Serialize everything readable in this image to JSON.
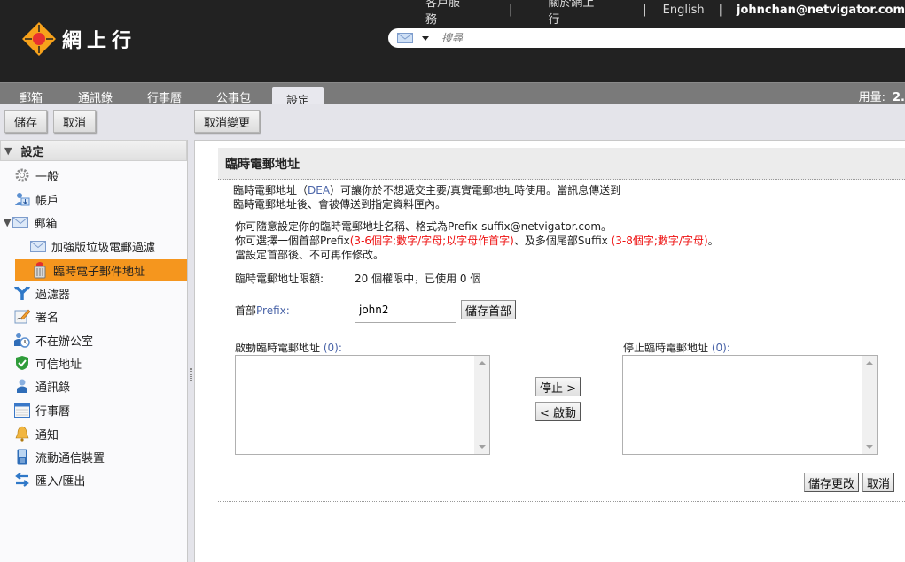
{
  "brand": {
    "name": "網上行"
  },
  "top_links": {
    "customer_service": "客戶服務",
    "about": "關於網上行",
    "language": "English",
    "separator": "|",
    "user_email": "johnchan@netvigator.com"
  },
  "search": {
    "placeholder": "搜尋",
    "mode_icon": "mail-icon"
  },
  "tabs": [
    {
      "label": "郵箱",
      "active": false
    },
    {
      "label": "通訊錄",
      "active": false
    },
    {
      "label": "行事曆",
      "active": false
    },
    {
      "label": "公事包",
      "active": false
    },
    {
      "label": "設定",
      "active": true
    }
  ],
  "usage": {
    "label": "用量:",
    "value": "2."
  },
  "toolbar": {
    "save": "儲存",
    "cancel": "取消",
    "undo_changes": "取消變更"
  },
  "sidebar": {
    "header": "設定",
    "items": [
      {
        "label": "一般",
        "icon": "gear-icon"
      },
      {
        "label": "帳戶",
        "icon": "account-icon"
      },
      {
        "label": "郵箱",
        "icon": "envelope-icon",
        "expanded": true
      },
      {
        "label": "加強版垃圾電郵過濾",
        "icon": "envelope-icon",
        "child": true
      },
      {
        "label": "臨時電子郵件地址",
        "icon": "trash-bin-icon",
        "child": true,
        "selected": true
      },
      {
        "label": "過濾器",
        "icon": "filter-fork-icon"
      },
      {
        "label": "署名",
        "icon": "signature-icon"
      },
      {
        "label": "不在辦公室",
        "icon": "out-of-office-icon"
      },
      {
        "label": "可信地址",
        "icon": "shield-check-icon"
      },
      {
        "label": "通訊錄",
        "icon": "contact-person-icon"
      },
      {
        "label": "行事曆",
        "icon": "calendar-icon"
      },
      {
        "label": "通知",
        "icon": "bell-icon"
      },
      {
        "label": "流動通信裝置",
        "icon": "mobile-device-icon"
      },
      {
        "label": "匯入/匯出",
        "icon": "import-export-icon"
      }
    ]
  },
  "main": {
    "title": "臨時電郵地址",
    "intro_1a": "臨時電郵地址（",
    "intro_1b": "DEA",
    "intro_1c": "）可讓你於不想遞交主要/真實電郵地址時使用。當訊息傳送到",
    "intro_2": "臨時電郵地址後、會被傳送到指定資料匣內。",
    "info_1": "你可隨意設定你的臨時電郵地址名稱、格式為Prefix-suffix@netvigator.com。",
    "info_2a": "你可選擇一個首部Prefix",
    "info_2b": "(3-6個字;數字/字母;以字母作首字)",
    "info_2c": "、及多個尾部Suffix ",
    "info_2d": "(3-8個字;數字/字母)",
    "info_2e": "。",
    "info_3": "當設定首部後、不可再作修改。",
    "quota_label": "臨時電郵地址限額:",
    "quota_value": "20 個權限中，已使用 0 個",
    "prefix_label_a": "首部",
    "prefix_label_b": "Prefix:",
    "prefix_value": "john2",
    "save_prefix": "儲存首部",
    "active_label": "啟動臨時電郵地址 ",
    "active_count": "(0):",
    "inactive_label": "停止臨時電郵地址 ",
    "inactive_count": "(0):",
    "deactivate_btn": "停止 >",
    "activate_btn": "< 啟動",
    "save_changes": "儲存更改",
    "cancel": "取消"
  },
  "colors": {
    "accent": "#f5961e",
    "header_bg": "#222222",
    "warning_text": "#ee1111"
  }
}
